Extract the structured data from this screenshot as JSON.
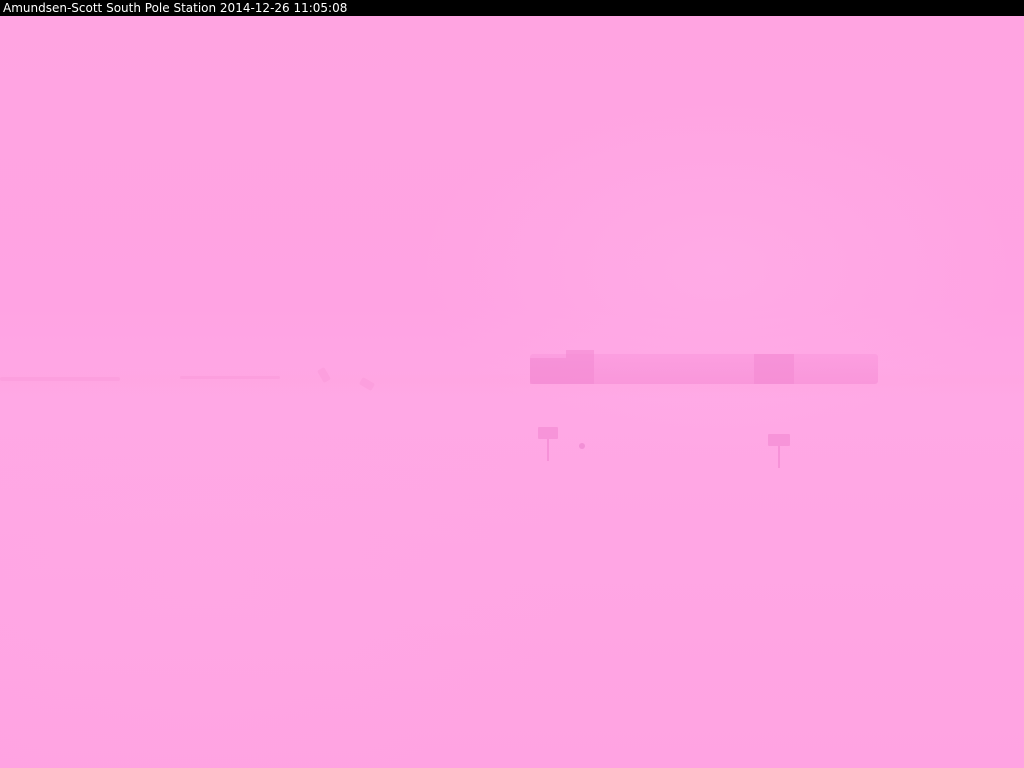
{
  "caption": {
    "text": "Amundsen-Scott South Pole Station 2014-12-26 11:05:08"
  },
  "colors": {
    "caption_background": "#000000",
    "caption_text": "#ffffff",
    "sky_tint": "#ffa3e2",
    "station_tint": "#f68ed6"
  },
  "scene": {
    "description_items": [
      "distant-ridge-icon",
      "station-building",
      "signpost-icon"
    ]
  }
}
